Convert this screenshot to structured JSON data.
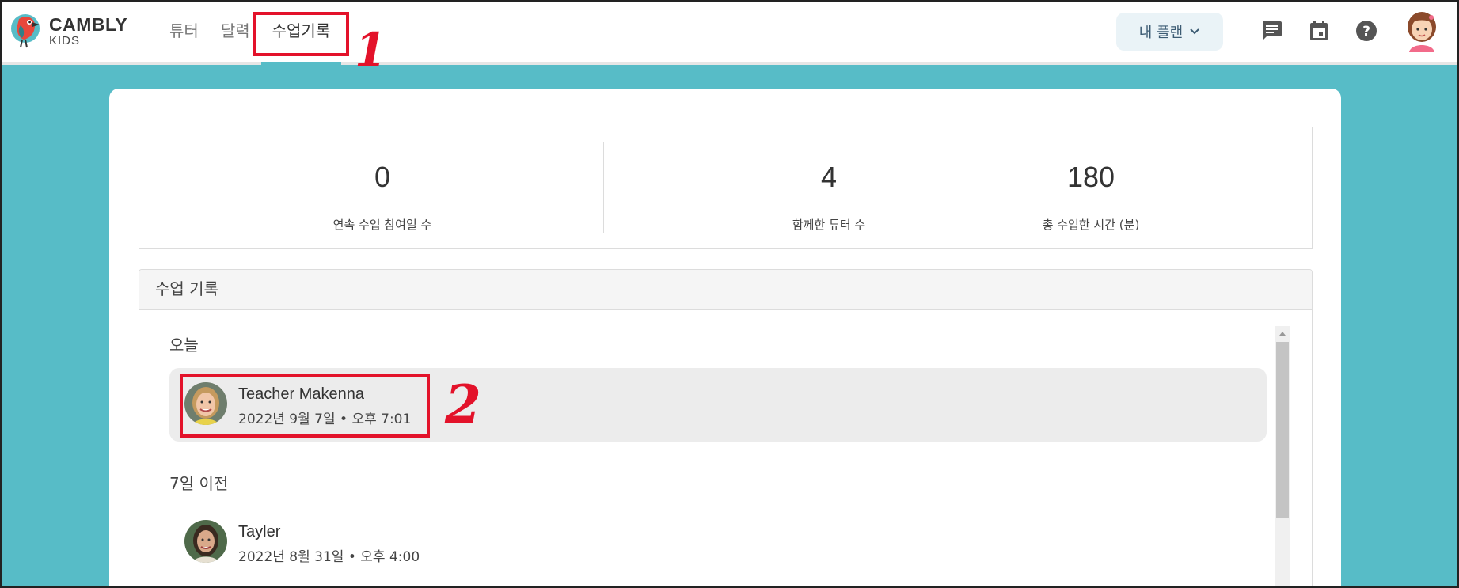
{
  "brand": {
    "name": "CAMBLY",
    "sub": "KIDS"
  },
  "nav": {
    "tabs": [
      {
        "label": "튜터"
      },
      {
        "label": "달력"
      },
      {
        "label": "수업기록"
      }
    ]
  },
  "plan_button": {
    "label": "내 플랜"
  },
  "header_icons": [
    "chat-icon",
    "calendar-icon",
    "help-icon",
    "user-avatar"
  ],
  "stats": [
    {
      "value": "0",
      "label": "연속 수업 참여일 수"
    },
    {
      "value": "4",
      "label": "함께한 튜터 수"
    },
    {
      "value": "180",
      "label": "총 수업한 시간 (분)"
    }
  ],
  "history": {
    "title": "수업 기록",
    "groups": [
      {
        "title": "오늘",
        "lessons": [
          {
            "name": "Teacher Makenna",
            "date": "2022년 9월 7일 • 오후 7:01"
          }
        ]
      },
      {
        "title": "7일 이전",
        "lessons": [
          {
            "name": "Tayler",
            "date": "2022년 8월 31일 • 오후 4:00"
          }
        ]
      }
    ]
  },
  "annotations": {
    "step1": "1",
    "step2": "2"
  },
  "colors": {
    "accent": "#57bcc7",
    "annotation": "#e3122a",
    "plan_bg": "#eaf3f7",
    "plan_text": "#3c5b73"
  }
}
